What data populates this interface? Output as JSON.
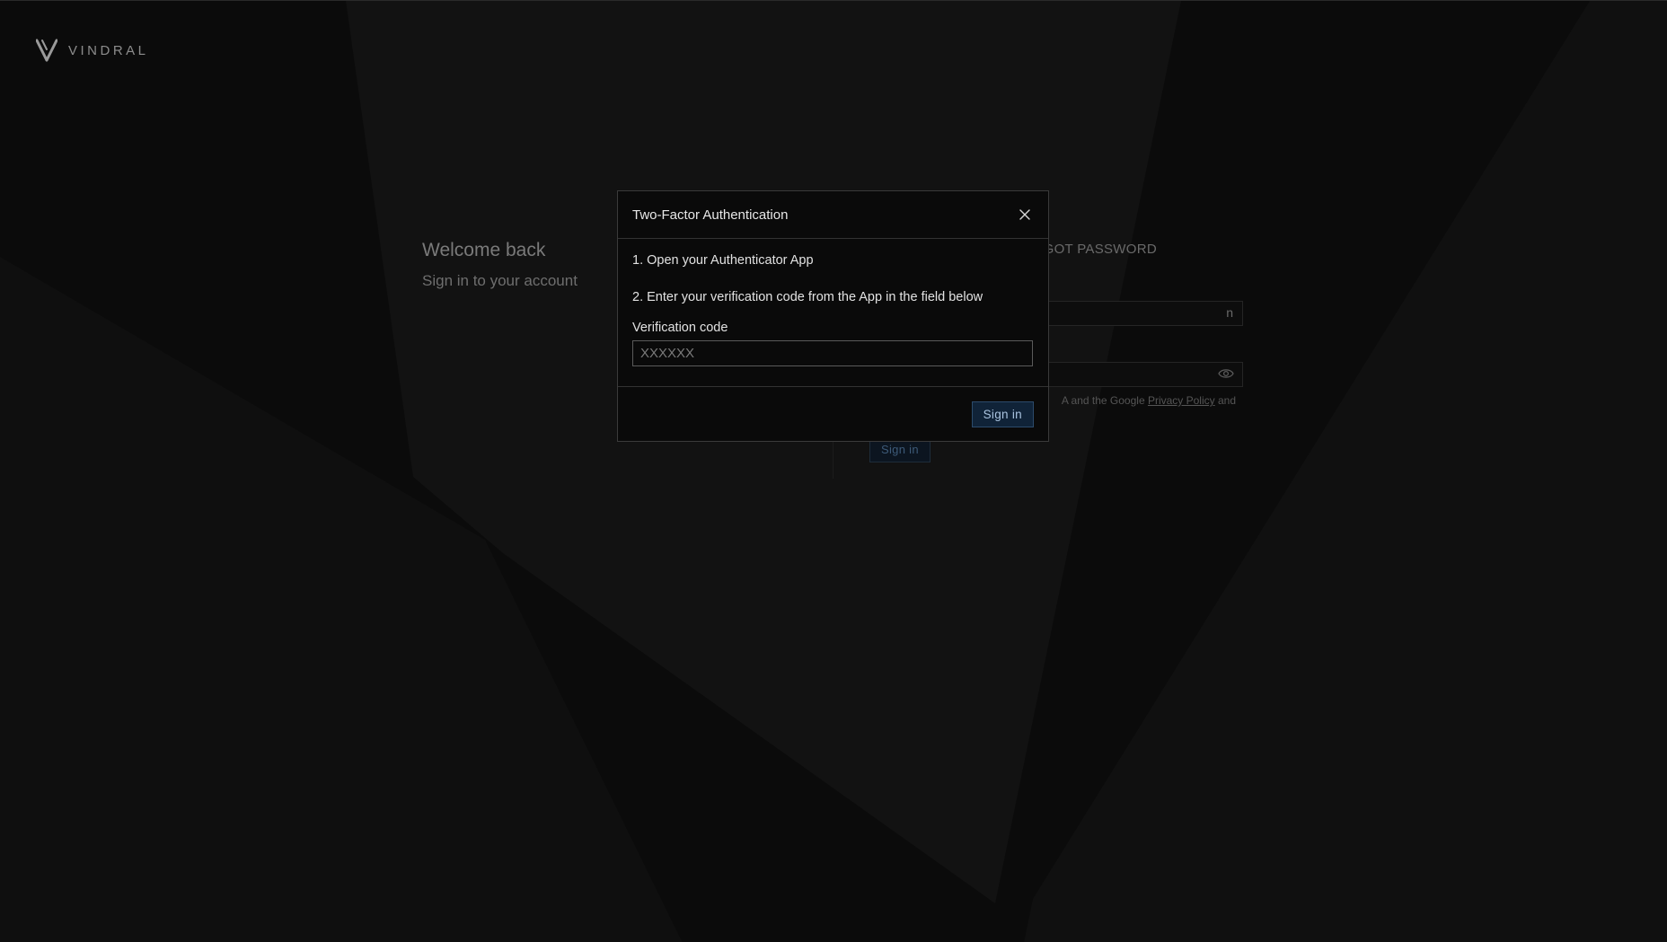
{
  "brand": {
    "name": "VINDRAL"
  },
  "signin_page": {
    "welcome_title": "Welcome back",
    "welcome_subtitle": "Sign in to your account",
    "forgot_password": "RGOT PASSWORD",
    "email_value": "n",
    "password_value": "",
    "recaptcha_prefix": "A and the Google ",
    "privacy_policy_link": "Privacy Policy",
    "recaptcha_suffix": " and",
    "signin_button": "Sign in"
  },
  "modal": {
    "title": "Two-Factor Authentication",
    "step_1": "1. Open your Authenticator App",
    "step_2": "2. Enter your verification code from the App in the field below",
    "field_label": "Verification code",
    "field_placeholder": "XXXXXX",
    "field_value": "",
    "submit_label": "Sign in"
  },
  "colors": {
    "background": "#0b0b0b",
    "modal_background": "#0a0a0a",
    "primary_button": "#102338",
    "primary_button_text": "#aac4e0"
  },
  "icons": {
    "logo": "vindral-v-logo",
    "close": "close-icon",
    "password_toggle": "eye-icon"
  }
}
